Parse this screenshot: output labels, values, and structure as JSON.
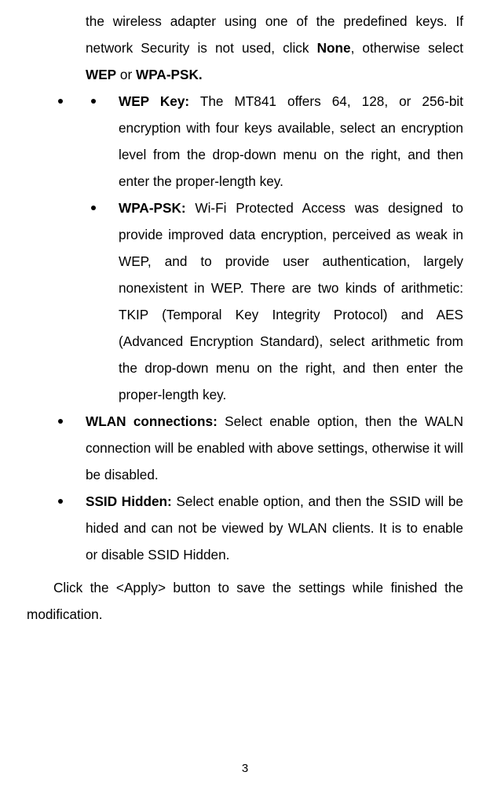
{
  "leading": {
    "t0": "the wireless adapter using one of the predefined keys. If network Security is not used, click ",
    "b0": "None",
    "t1": ", otherwise select ",
    "b1": "WEP",
    "t2": " or ",
    "b2": "WPA-PSK."
  },
  "wep": {
    "label": "WEP Key:",
    "text": " The MT841 offers 64, 128, or 256-bit encryption with four keys available, select an encryption level from the drop-down menu on the right, and then enter the proper-length key."
  },
  "wpa": {
    "label": "WPA-PSK:",
    "text": " Wi-Fi Protected Access was designed to provide improved data encryption, perceived as weak in WEP, and to provide user authentication, largely nonexistent in WEP. There are two kinds of arithmetic: TKIP (Temporal Key Integrity Protocol) and AES (Advanced Encryption Standard), select arithmetic from the drop-down menu on the right, and then enter the proper-length key."
  },
  "wlan": {
    "label": "WLAN connections:",
    "text": " Select enable option, then the WALN connection will be enabled with above settings, otherwise it will be disabled."
  },
  "ssid": {
    "label": "SSID Hidden:",
    "text": " Select enable option, and then the SSID will be hided and can not be viewed by WLAN clients.  It is to enable or disable SSID Hidden."
  },
  "closing": "Click the <Apply> button to save the settings while finished the modification.",
  "page_number": "3"
}
